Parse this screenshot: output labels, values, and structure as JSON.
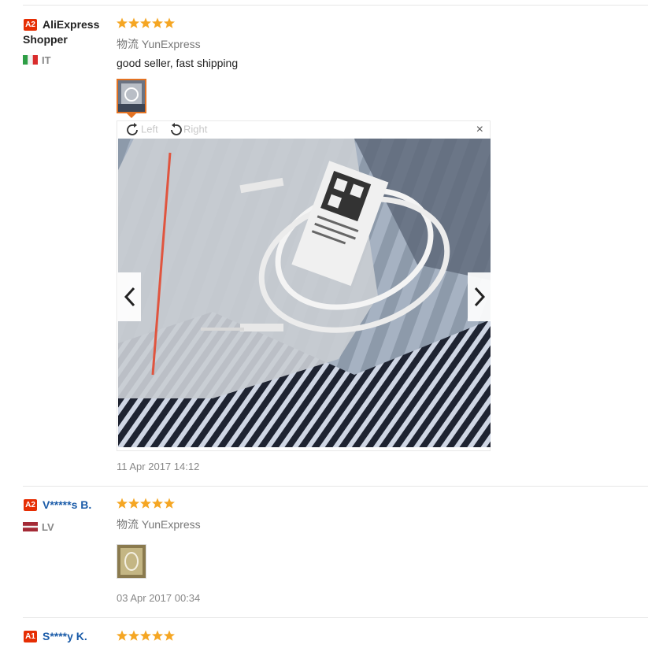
{
  "reviews": [
    {
      "level": "A2",
      "name_line1": "AliExpress",
      "name_line2": "Shopper",
      "country": "IT",
      "rating": 5,
      "shipping": "物流 YunExpress",
      "content": "good seller, fast shipping",
      "date": "11 Apr 2017 14:12"
    },
    {
      "level": "A2",
      "name": "V*****s B.",
      "country": "LV",
      "rating": 5,
      "shipping": "物流 YunExpress",
      "date": "03 Apr 2017 00:34"
    },
    {
      "level": "A1",
      "name": "S****y K.",
      "rating": 5
    }
  ],
  "viewer": {
    "rotate_left": "Left",
    "rotate_right": "Right",
    "close": "×"
  },
  "icons": {
    "star": "star-icon",
    "rotate_left": "rotate-left-icon",
    "rotate_right": "rotate-right-icon",
    "prev": "chevron-left-icon",
    "next": "chevron-right-icon"
  },
  "colors": {
    "level_badge": "#e62e04",
    "star": "#f5a623",
    "username_link": "#1a5ba8",
    "active_thumb_border": "#e37222"
  }
}
